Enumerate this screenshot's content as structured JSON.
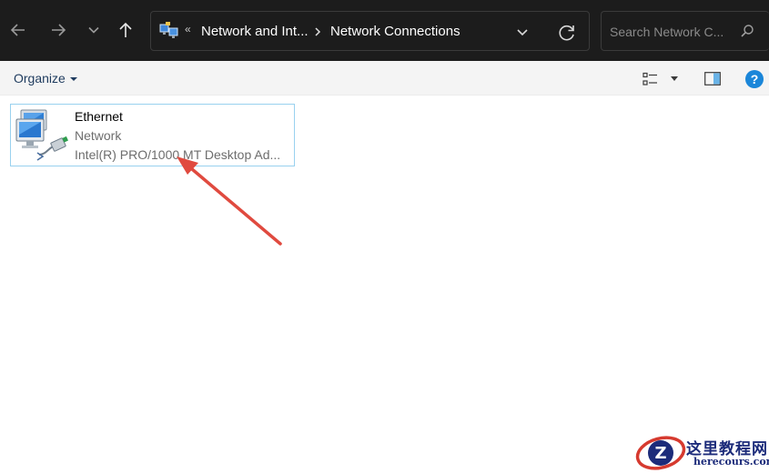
{
  "address_bar": {
    "breadcrumbs": [
      "Network and Int...",
      "Network Connections"
    ],
    "overflow_glyph": "«",
    "location_icon": "network-connections-icon"
  },
  "navigation": {
    "back_icon": "arrow-left-icon",
    "forward_icon": "arrow-right-icon",
    "recent_icon": "chevron-down-icon",
    "up_icon": "arrow-up-icon",
    "refresh_icon": "refresh-icon"
  },
  "search": {
    "placeholder": "Search Network C...",
    "value": ""
  },
  "command_bar": {
    "organize_label": "Organize",
    "view_icon": "details-view-icon",
    "preview_pane_icon": "preview-pane-icon",
    "help_label": "?"
  },
  "connections": [
    {
      "name": "Ethernet",
      "type": "Network",
      "device": "Intel(R) PRO/1000 MT Desktop Ad...",
      "icon": "ethernet-adapter-icon"
    }
  ],
  "annotation": {
    "arrow_color": "#e04a3f"
  },
  "watermark": {
    "cn_text": "这里教程网",
    "en_text": "herecours.com",
    "logo_letter": "Z"
  },
  "colors": {
    "titlebar_bg": "#1c1c1c",
    "selection_border": "#99d1ef",
    "help_blue": "#1a86d9"
  }
}
